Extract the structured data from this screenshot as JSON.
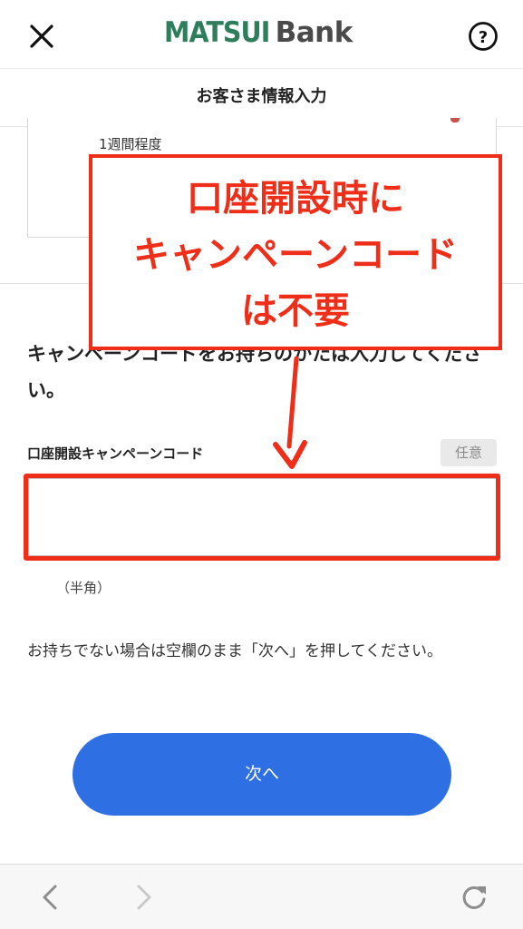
{
  "header": {
    "logo_primary": "MATSUI",
    "logo_secondary": "Bank",
    "close_icon": "close-icon",
    "help_icon": "help-circle-icon",
    "brand_color": "#2e7d5b"
  },
  "subheader": {
    "title": "お客さま情報入力"
  },
  "info_card": {
    "text": "1週間程度"
  },
  "main": {
    "heading": "キャンペーンコードをお持ちのかたは入力してください。",
    "field_label": "口座開設キャンペーンコード",
    "optional_badge": "任意",
    "input_value": "",
    "hint": "（半角）",
    "note": "お持ちでない場合は空欄のまま「次へ」を押してください。",
    "next_button": "次へ",
    "button_color": "#2f6fe4"
  },
  "annotation": {
    "lines": [
      "口座開設時に",
      "キャンペーンコード",
      "は不要"
    ],
    "color": "#ee2e18"
  },
  "toolbar": {
    "back_icon": "chevron-left-icon",
    "forward_icon": "chevron-right-icon",
    "reload_icon": "reload-icon"
  }
}
